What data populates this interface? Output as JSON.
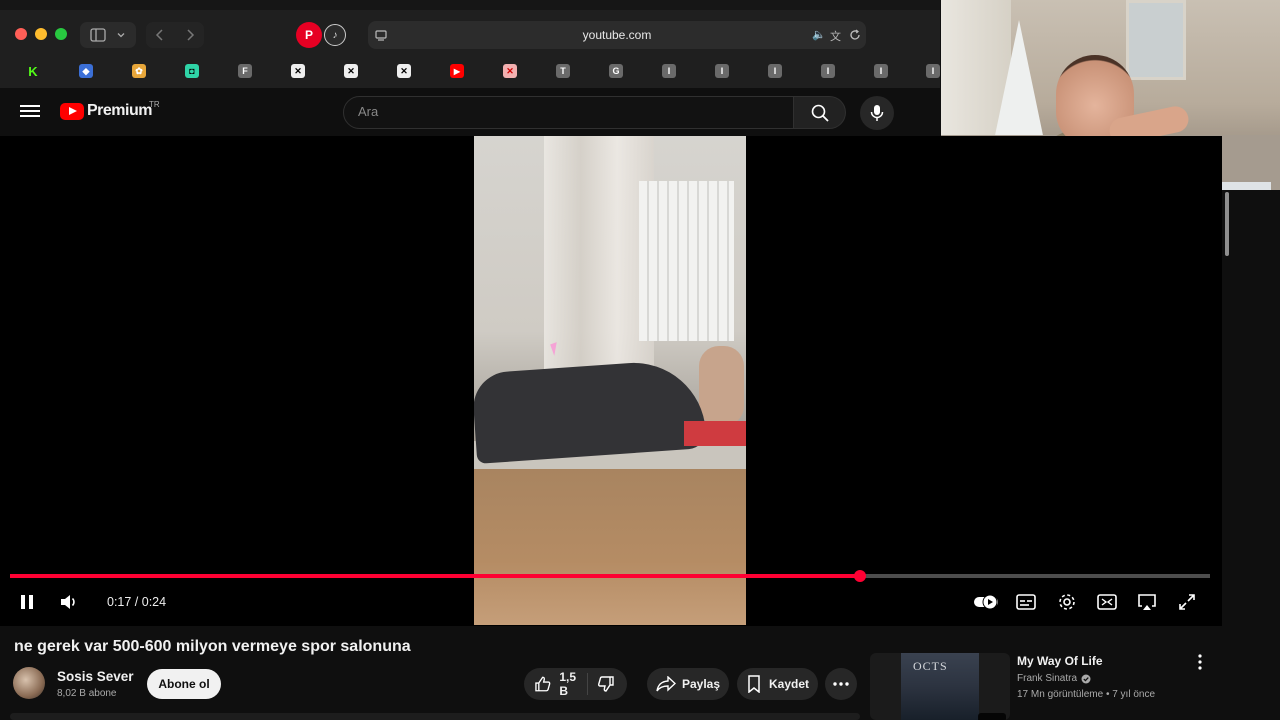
{
  "browser": {
    "url": "youtube.com"
  },
  "header": {
    "logo_text": "Premium",
    "country_code": "TR",
    "search_placeholder": "Ara"
  },
  "player": {
    "time_display": "0:17 / 0:24",
    "progress_fraction": 0.7083
  },
  "video": {
    "title": "ne gerek var 500-600 milyon vermeye spor salonuna",
    "channel_name": "Sosis Sever",
    "subscribers": "8,02 B abone",
    "subscribe_label": "Abone ol",
    "likes": "1,5 B",
    "share_label": "Paylaş",
    "save_label": "Kaydet"
  },
  "recommendation": {
    "title": "My Way Of Life",
    "artist": "Frank Sinatra",
    "meta": "17 Mn görüntüleme • 7 yıl önce",
    "cover_text": "OCTS"
  },
  "colors": {
    "progress": "#ff0033",
    "youtube_red": "#ff0000",
    "background": "#0f0f0f"
  }
}
